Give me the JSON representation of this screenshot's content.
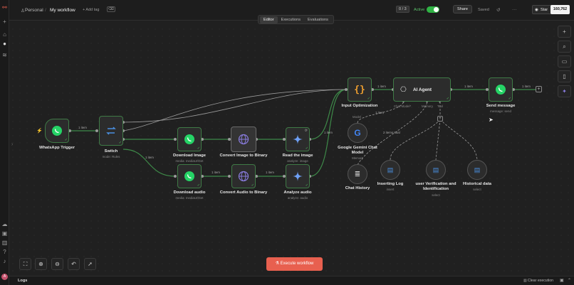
{
  "breadcrumb": {
    "project": "Personal",
    "separator": "/",
    "workflow": "My workflow",
    "add_tag": "+ Add tag"
  },
  "header": {
    "counter": "0 / 3",
    "active_label": "Active",
    "share_label": "Share",
    "saved_label": "Saved",
    "more": "···",
    "star_label": "Star",
    "star_count": "160,762"
  },
  "tabs": [
    "Editor",
    "Executions",
    "Evaluations"
  ],
  "nodes": {
    "whatsapp_trigger": {
      "label": "WhatsApp Trigger"
    },
    "switch": {
      "label": "Switch",
      "sub": "mode: Rules"
    },
    "download_image": {
      "label": "Download Image",
      "sub": "media: mediaUrlGet"
    },
    "convert_image": {
      "label": "Convert Image to Binary"
    },
    "read_image": {
      "label": "Read the image",
      "sub": "analyze: image"
    },
    "download_audio": {
      "label": "Download audio",
      "sub": "media: mediaUrlGet"
    },
    "convert_audio": {
      "label": "Convert Audio to Binary"
    },
    "analyze_audio": {
      "label": "Analyze audio",
      "sub": "analyze: audio"
    },
    "input_opt": {
      "label": "Input Optimization"
    },
    "ai_agent": {
      "label": "AI Agent",
      "chat_model": "Chat Model*",
      "memory": "Memory",
      "tool": "Tool"
    },
    "send_message": {
      "label": "Send message",
      "sub": "message: send"
    },
    "gemini": {
      "label1": "Google Gemini Chat",
      "label2": "Model",
      "tag": "Model",
      "sub": "Memory"
    },
    "chat_history": {
      "label": "Chat History"
    },
    "inserting_log": {
      "label": "Inserting Log",
      "sub": "insert"
    },
    "user_verify": {
      "label1": "user Verification and",
      "label2": "Identification",
      "sub": "select"
    },
    "historical": {
      "label": "Historical data",
      "sub": "select"
    }
  },
  "edge_labels": {
    "trigger_switch": "1 item",
    "switch_audio": "1 item",
    "audio_convert": "1 item",
    "convert_analyze": "1 item",
    "read_input": "1 item",
    "input_agent": "1 item",
    "agent_send": "1 item",
    "send_out": "1 item",
    "gemini_agent": "1 item",
    "tools_total": "2 items total"
  },
  "bottom": {
    "execute_label": "Execute workflow",
    "logs_label": "Logs",
    "clear_label": "Clear execution"
  },
  "colors": {
    "accent": "#e8604f",
    "node_border": "#3f7a46",
    "edge": "#3e8a49",
    "whatsapp": "#25d366",
    "toggle": "#2fb344"
  }
}
